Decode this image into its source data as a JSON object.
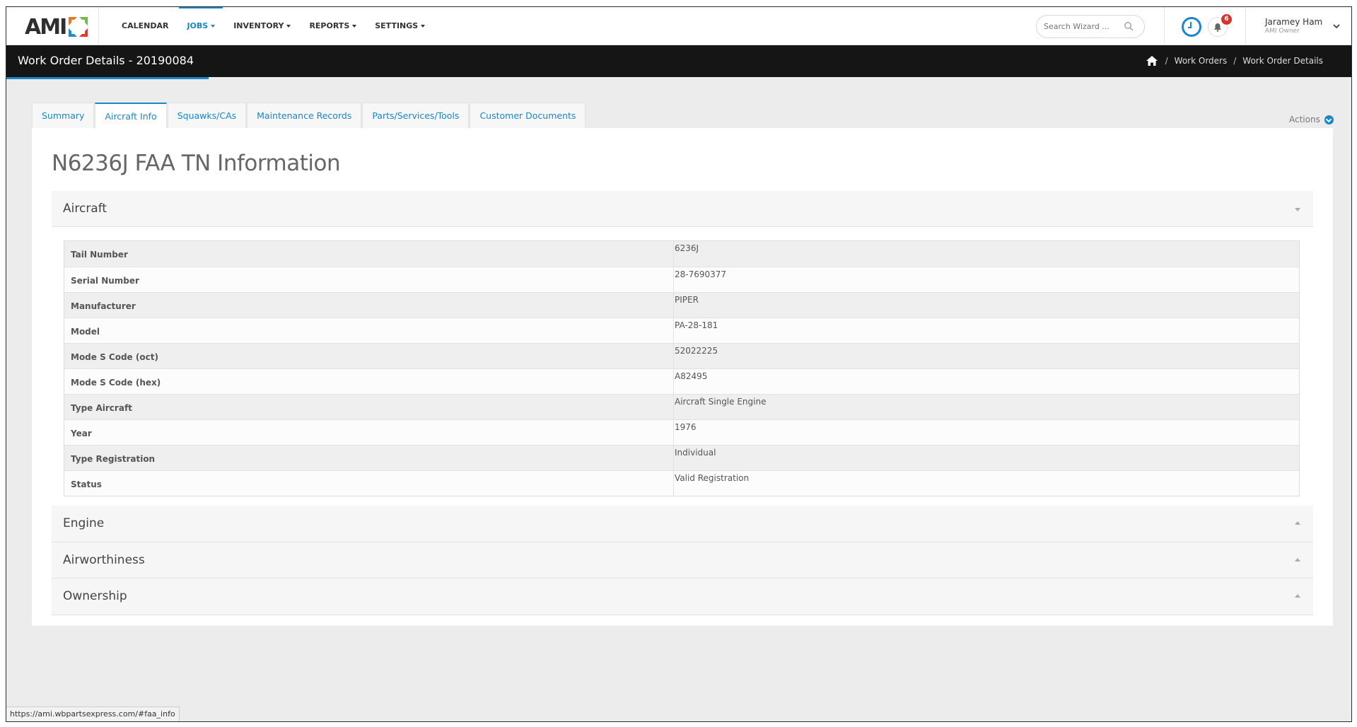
{
  "app": {
    "logo_text": "AMI",
    "menu": [
      {
        "label": "CALENDAR",
        "dropdown": false,
        "active": false
      },
      {
        "label": "JOBS",
        "dropdown": true,
        "active": true
      },
      {
        "label": "INVENTORY",
        "dropdown": true,
        "active": false
      },
      {
        "label": "REPORTS",
        "dropdown": true,
        "active": false
      },
      {
        "label": "SETTINGS",
        "dropdown": true,
        "active": false
      }
    ],
    "search_placeholder": "Search Wizard ...",
    "notifications_count": "6",
    "user": {
      "name": "Jaramey Ham",
      "role": "AMI Owner"
    },
    "accent_color": "#1a87c9"
  },
  "titlebar": {
    "title": "Work Order Details - 20190084",
    "breadcrumb": [
      "Work Orders",
      "Work Order Details"
    ]
  },
  "tabs": [
    {
      "label": "Summary",
      "active": false
    },
    {
      "label": "Aircraft Info",
      "active": true
    },
    {
      "label": "Squawks/CAs",
      "active": false
    },
    {
      "label": "Maintenance Records",
      "active": false
    },
    {
      "label": "Parts/Services/Tools",
      "active": false
    },
    {
      "label": "Customer Documents",
      "active": false
    }
  ],
  "actions_label": "Actions",
  "main": {
    "heading": "N6236J FAA TN Information",
    "sections": [
      {
        "title": "Aircraft",
        "expanded": true
      },
      {
        "title": "Engine",
        "expanded": false
      },
      {
        "title": "Airworthiness",
        "expanded": false
      },
      {
        "title": "Ownership",
        "expanded": false
      }
    ],
    "aircraft_rows": [
      {
        "label": "Tail Number",
        "value": "6236J"
      },
      {
        "label": "Serial Number",
        "value": "28-7690377"
      },
      {
        "label": "Manufacturer",
        "value": "PIPER"
      },
      {
        "label": "Model",
        "value": "PA-28-181"
      },
      {
        "label": "Mode S Code (oct)",
        "value": "52022225"
      },
      {
        "label": "Mode S Code (hex)",
        "value": "A82495"
      },
      {
        "label": "Type Aircraft",
        "value": "Aircraft Single Engine"
      },
      {
        "label": "Year",
        "value": "1976"
      },
      {
        "label": "Type Registration",
        "value": "Individual"
      },
      {
        "label": "Status",
        "value": "Valid Registration"
      }
    ]
  },
  "status_url": "https://ami.wbpartsexpress.com/#faa_info"
}
